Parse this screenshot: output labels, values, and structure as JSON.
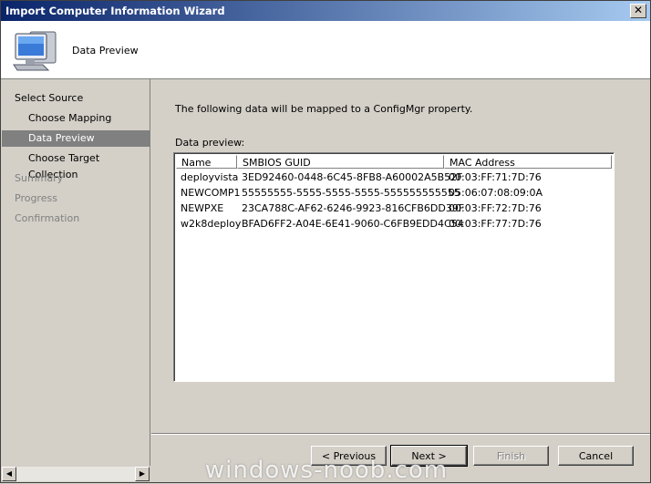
{
  "window": {
    "title": "Import Computer Information Wizard",
    "close_glyph": "✕"
  },
  "header": {
    "title": "Data Preview",
    "icon": "computer-monitor-icon"
  },
  "sidebar": {
    "items": [
      {
        "label": "Select Source",
        "state": "normal"
      },
      {
        "label": "Choose Mapping",
        "state": "normal"
      },
      {
        "label": "Data Preview",
        "state": "selected"
      },
      {
        "label": "Choose Target Collection",
        "state": "normal"
      },
      {
        "label": "Summary",
        "state": "disabled"
      },
      {
        "label": "Progress",
        "state": "disabled"
      },
      {
        "label": "Confirmation",
        "state": "disabled"
      }
    ]
  },
  "main": {
    "intro": "The following data will be mapped to a ConfigMgr property.",
    "preview_label": "Data preview:",
    "columns": [
      "Name",
      "SMBIOS GUID",
      "MAC Address"
    ],
    "rows": [
      [
        "deployvista",
        "3ED92460-0448-6C45-8FB8-A60002A5B52F",
        "00:03:FF:71:7D:76"
      ],
      [
        "NEWCOMP1",
        "55555555-5555-5555-5555-555555555555",
        "05:06:07:08:09:0A"
      ],
      [
        "NEWPXE",
        "23CA788C-AF62-6246-9923-816CFB6DD39F",
        "00:03:FF:72:7D:76"
      ],
      [
        "w2k8deploy",
        "BFAD6FF2-A04E-6E41-9060-C6FB9EDD4C54",
        "00:03:FF:77:7D:76"
      ]
    ]
  },
  "buttons": {
    "previous": "< Previous",
    "next": "Next >",
    "finish": "Finish",
    "cancel": "Cancel"
  },
  "watermark": "windows-noob.com",
  "colors": {
    "title_gradient_start": "#0a246a",
    "title_gradient_end": "#a6caf0",
    "selected_nav": "#808080",
    "face": "#d4d0c8"
  }
}
